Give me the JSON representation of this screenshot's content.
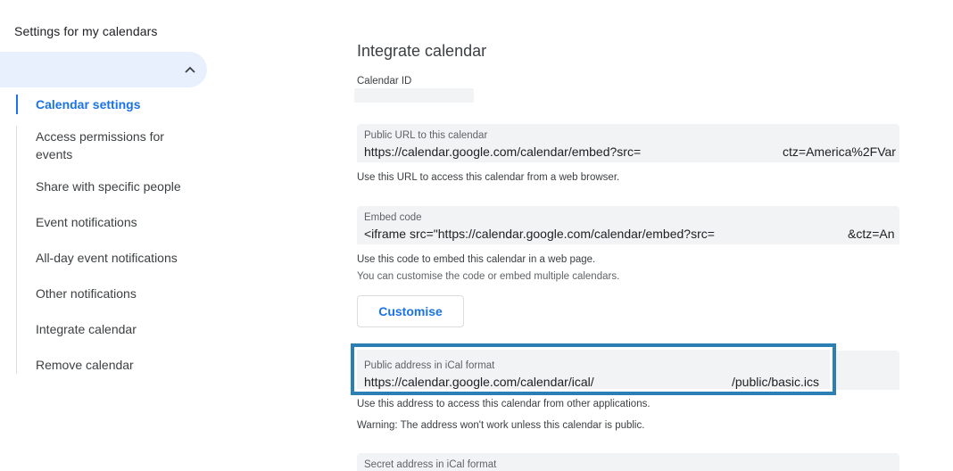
{
  "sidebar": {
    "title": "Settings for my calendars",
    "items": [
      {
        "label": "Calendar settings",
        "active": true
      },
      {
        "label": "Access permissions for events"
      },
      {
        "label": "Share with specific people"
      },
      {
        "label": "Event notifications"
      },
      {
        "label": "All-day event notifications"
      },
      {
        "label": "Other notifications"
      },
      {
        "label": "Integrate calendar"
      },
      {
        "label": "Remove calendar"
      }
    ],
    "icons": {
      "collapse": "chevron-up-icon"
    }
  },
  "main": {
    "title": "Integrate calendar",
    "calendar_id": {
      "label": "Calendar ID"
    },
    "public_url": {
      "label": "Public URL to this calendar",
      "value_start": "https://calendar.google.com/calendar/embed?src=",
      "value_end": "ctz=America%2FVar",
      "help": "Use this URL to access this calendar from a web browser."
    },
    "embed": {
      "label": "Embed code",
      "value_start": "<iframe src=\"https://calendar.google.com/calendar/embed?src=",
      "value_end": "&ctz=An",
      "help": "Use this code to embed this calendar in a web page.",
      "help2": "You can customise the code or embed multiple calendars.",
      "button": "Customise"
    },
    "ical_public": {
      "label": "Public address in iCal format",
      "value_start": "https://calendar.google.com/calendar/ical/",
      "value_end": "/public/basic.ics",
      "help": "Use this address to access this calendar from other applications.",
      "warning": "Warning: The address won't work unless this calendar is public."
    },
    "ical_secret": {
      "label": "Secret address in iCal format"
    }
  },
  "colors": {
    "accent": "#1a73e8",
    "highlight_border": "#2b7fb5",
    "field_bg": "#f1f3f4"
  }
}
